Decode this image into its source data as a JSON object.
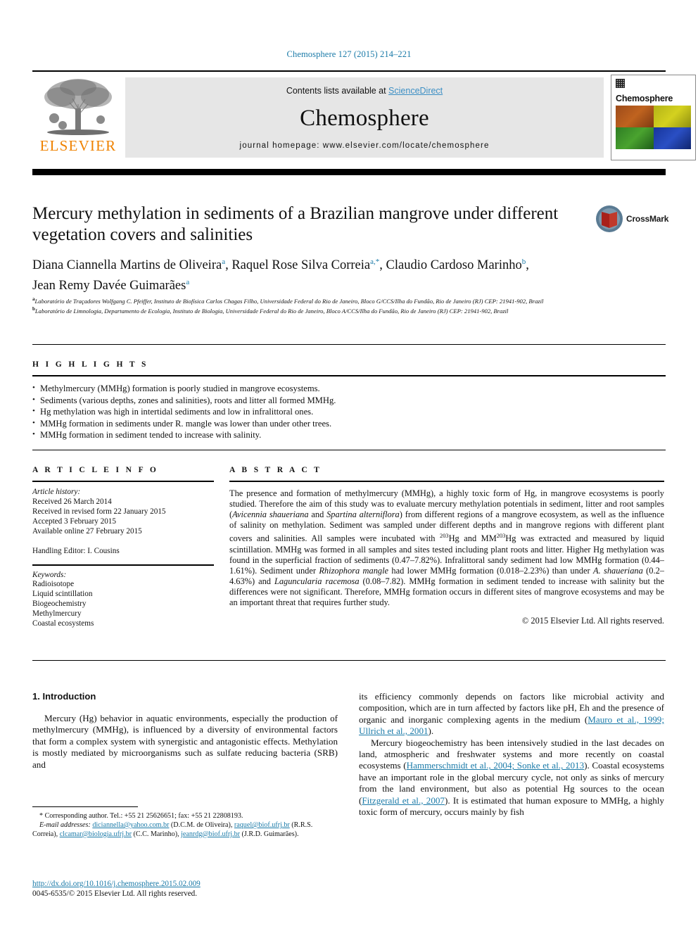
{
  "running_head": "Chemosphere 127 (2015) 214–221",
  "header": {
    "publisher_name": "ELSEVIER",
    "contents_text": "Contents lists available at ",
    "sciencedirect": "ScienceDirect",
    "journal_title": "Chemosphere",
    "journal_homepage": "journal homepage: www.elsevier.com/locate/chemosphere",
    "cover_journal_name": "Chemosphere"
  },
  "article": {
    "title": "Mercury methylation in sediments of a Brazilian mangrove under different vegetation covers and salinities",
    "crossmark_label": "CrossMark",
    "authors_line1_a": "Diana Ciannella Martins de Oliveira",
    "authors_mark_a": "a",
    "authors_line1_b": ", Raquel Rose Silva Correia",
    "authors_mark_b": "a,*",
    "authors_line1_c": ", Claudio Cardoso Marinho",
    "authors_mark_c": "b",
    "authors_line1_d": ",",
    "authors_line2": "Jean Remy Davée Guimarães",
    "authors_mark_d": "a",
    "affiliation_a_mark": "a",
    "affiliation_a": "Laboratório de Traçadores Wolfgang C. Pfeiffer, Instituto de Biofísica Carlos Chagas Filho, Universidade Federal do Rio de Janeiro, Bloco G/CCS/Ilha do Fundão, Rio de Janeiro (RJ) CEP: 21941-902, Brazil",
    "affiliation_b_mark": "b",
    "affiliation_b": "Laboratório de Limnologia, Departamento de Ecologia, Instituto de Biologia, Universidade Federal do Rio de Janeiro, Bloco A/CCS/Ilha do Fundão, Rio de Janeiro (RJ) CEP: 21941-902, Brazil"
  },
  "highlights": {
    "heading": "H I G H L I G H T S",
    "items": [
      "Methylmercury (MMHg) formation is poorly studied in mangrove ecosystems.",
      "Sediments (various depths, zones and salinities), roots and litter all formed MMHg.",
      "Hg methylation was high in intertidal sediments and low in infralittoral ones.",
      "MMHg formation in sediments under R. mangle was lower than under other trees.",
      "MMHg formation in sediment tended to increase with salinity."
    ]
  },
  "article_info": {
    "heading": "A R T I C L E    I N F O",
    "history_label": "Article history:",
    "history": [
      "Received 26 March 2014",
      "Received in revised form 22 January 2015",
      "Accepted 3 February 2015",
      "Available online 27 February 2015"
    ],
    "handling_editor": "Handling Editor: I. Cousins",
    "keywords_label": "Keywords:",
    "keywords": [
      "Radioisotope",
      "Liquid scintillation",
      "Biogeochemistry",
      "Methylmercury",
      "Coastal ecosystems"
    ]
  },
  "abstract": {
    "heading": "A B S T R A C T",
    "p1_a": "The presence and formation of methylmercury (MMHg), a highly toxic form of Hg, in mangrove ecosystems is poorly studied. Therefore the aim of this study was to evaluate mercury methylation potentials in sediment, litter and root samples (",
    "species1": "Avicennia shaueriana",
    "p1_b": " and ",
    "species2": "Spartina alterniflora",
    "p1_c": ") from different regions of a mangrove ecosystem, as well as the influence of salinity on methylation. Sediment was sampled under different depths and in mangrove regions with different plant covers and salinities. All samples were incubated with ",
    "iso1": "203",
    "p1_d": "Hg and MM",
    "iso2": "203",
    "p1_e": "Hg was extracted and measured by liquid scintillation. MMHg was formed in all samples and sites tested including plant roots and litter. Higher Hg methylation was found in the superficial fraction of sediments (0.47–7.82%). Infralittoral sandy sediment had low MMHg formation (0.44–1.61%). Sediment under ",
    "species3": "Rhizophora mangle",
    "p1_f": " had lower MMHg formation (0.018–2.23%) than under ",
    "species4": "A. shaueriana",
    "p1_g": " (0.2–4.63%) and ",
    "species5": "Laguncularia racemosa",
    "p1_h": " (0.08–7.82). MMHg formation in sediment tended to increase with salinity but the differences were not significant. Therefore, MMHg formation occurs in different sites of mangrove ecosystems and may be an important threat that requires further study.",
    "copyright": "© 2015 Elsevier Ltd. All rights reserved."
  },
  "body": {
    "section_heading": "1. Introduction",
    "left_p1": "Mercury (Hg) behavior in aquatic environments, especially the production of methylmercury (MMHg), is influenced by a diversity of environmental factors that form a complex system with synergistic and antagonistic effects. Methylation is mostly mediated by microorganisms such as sulfate reducing bacteria (SRB) and",
    "right_p1_a": "its efficiency commonly depends on factors like microbial activity and composition, which are in turn affected by factors like pH, Eh and the presence of organic and inorganic complexing agents in the medium (",
    "right_p1_cite": "Mauro et al., 1999; Ullrich et al., 2001",
    "right_p1_b": ").",
    "right_p2_a": "Mercury biogeochemistry has been intensively studied in the last decades on land, atmospheric and freshwater systems and more recently on coastal ecosystems (",
    "right_p2_cite1": "Hammerschmidt et al., 2004; Sonke et al., 2013",
    "right_p2_b": "). Coastal ecosystems have an important role in the global mercury cycle, not only as sinks of mercury from the land environment, but also as potential Hg sources to the ocean (",
    "right_p2_cite2": "Fitzgerald et al., 2007",
    "right_p2_c": "). It is estimated that human exposure to MMHg, a highly toxic form of mercury, occurs mainly by fish"
  },
  "footnotes": {
    "corresponding": "* Corresponding author. Tel.: +55 21 25626651; fax: +55 21 22808193.",
    "email_label": "E-mail addresses:",
    "email1": "diciannella@yahoo.com.br",
    "email1_owner": " (D.C.M. de Oliveira), ",
    "email2": "raquel@biof.ufrj.br",
    "email2_owner": " (R.R.S. Correia), ",
    "email3": "clcamar@biologia.ufrj.br",
    "email3_owner": " (C.C. Marinho), ",
    "email4": "jeanrdg@biof.ufrj.br",
    "email4_owner": " (J.R.D. Guimarães).",
    "doi": "http://dx.doi.org/10.1016/j.chemosphere.2015.02.009",
    "issn": "0045-6535/© 2015 Elsevier Ltd. All rights reserved."
  },
  "colors": {
    "link_teal": "#1a7aa8",
    "sciencedirect_blue": "#3c8fc4",
    "elsevier_orange": "#ef8200"
  }
}
